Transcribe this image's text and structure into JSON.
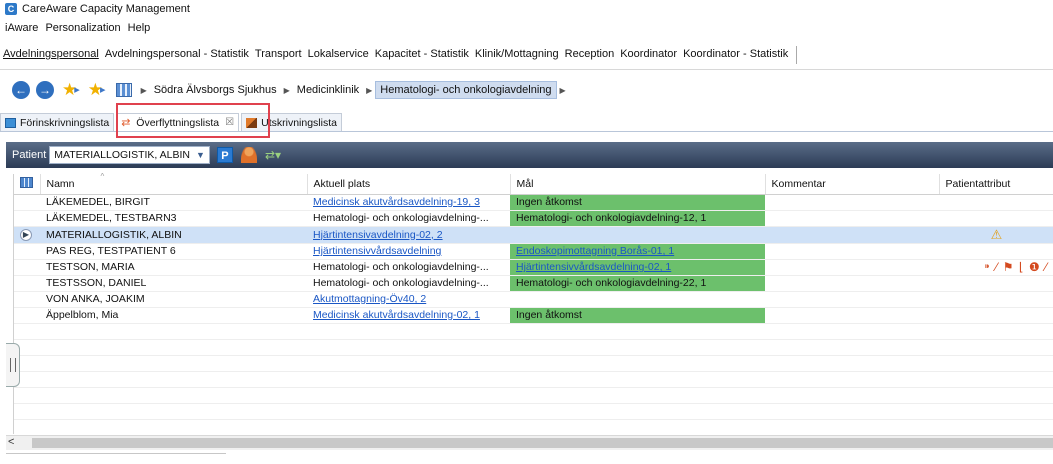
{
  "app": {
    "logo_letter": "C",
    "title": "CareAware Capacity Management"
  },
  "menu": [
    "iAware",
    "Personalization",
    "Help"
  ],
  "perspectives": [
    "Avdelningspersonal",
    "Avdelningspersonal - Statistik",
    "Transport",
    "Lokalservice",
    "Kapacitet - Statistik",
    "Klinik/Mottagning",
    "Reception",
    "Koordinator",
    "Koordinator - Statistik"
  ],
  "navigation": {
    "back_symbol": "←",
    "forward_symbol": "→",
    "breadcrumb": [
      "Södra Älvsborgs Sjukhus",
      "Medicinklinik",
      "Hematologi- och onkologiavdelning"
    ]
  },
  "tabs": [
    {
      "label": "Förinskrivningslista",
      "active": false
    },
    {
      "label": "Överflyttningslista",
      "active": true,
      "close": "☒"
    },
    {
      "label": "Utskrivningslista",
      "active": false
    }
  ],
  "patient_bar": {
    "label": "Patient",
    "selected": "MATERIALLOGISTIK, ALBIN",
    "p_label": "P"
  },
  "table": {
    "headers": [
      "Namn",
      "Aktuell plats",
      "Mål",
      "Kommentar",
      "Patientattribut"
    ],
    "rows": [
      {
        "name": "LÄKEMEDEL, BIRGIT",
        "location": "Medicinsk akutvårdsavdelning-19, 3",
        "target": "Ingen åtkomst",
        "comment": "",
        "attr": ""
      },
      {
        "name": "LÄKEMEDEL, TESTBARN3",
        "location": "Hematologi- och onkologiavdelning-...",
        "target": "Hematologi- och onkologiavdelning-12, 1",
        "comment": "",
        "attr": ""
      },
      {
        "name": "MATERIALLOGISTIK, ALBIN",
        "location": "Hjärtintensivavdelning-02, 2",
        "target": "",
        "comment": "",
        "attr": "⚠"
      },
      {
        "name": "PAS REG, TESTPATIENT 6",
        "location": "Hjärtintensivvårdsavdelning",
        "target": "Endoskopimottagning Borås-01, 1",
        "comment": "",
        "attr": ""
      },
      {
        "name": "TESTSON, MARIA",
        "location": "Hematologi- och onkologiavdelning-...",
        "target": "Hjärtintensivvårdsavdelning-02, 1",
        "comment": "",
        "attr": "⁍ ⁄ ⚑ ⌊ ❶ ⁄"
      },
      {
        "name": "TESTSSON, DANIEL",
        "location": "Hematologi- och onkologiavdelning-...",
        "target": "Hematologi- och onkologiavdelning-22, 1",
        "comment": "",
        "attr": ""
      },
      {
        "name": "VON ANKA, JOAKIM",
        "location": "Akutmottagning-Öv40, 2",
        "target": "",
        "comment": "",
        "attr": ""
      },
      {
        "name": "Äppelblom, Mia",
        "location": "Medicinsk akutvårdsavdelning-02, 1",
        "target": "Ingen åtkomst",
        "comment": "",
        "attr": ""
      }
    ]
  },
  "scrollbar": {
    "left_arrow": "<"
  },
  "colors": {
    "target_green": "#6cc06c",
    "link_blue": "#1a57c5",
    "selected_row": "#cfe1f7",
    "highlight_red": "#e0414e"
  }
}
